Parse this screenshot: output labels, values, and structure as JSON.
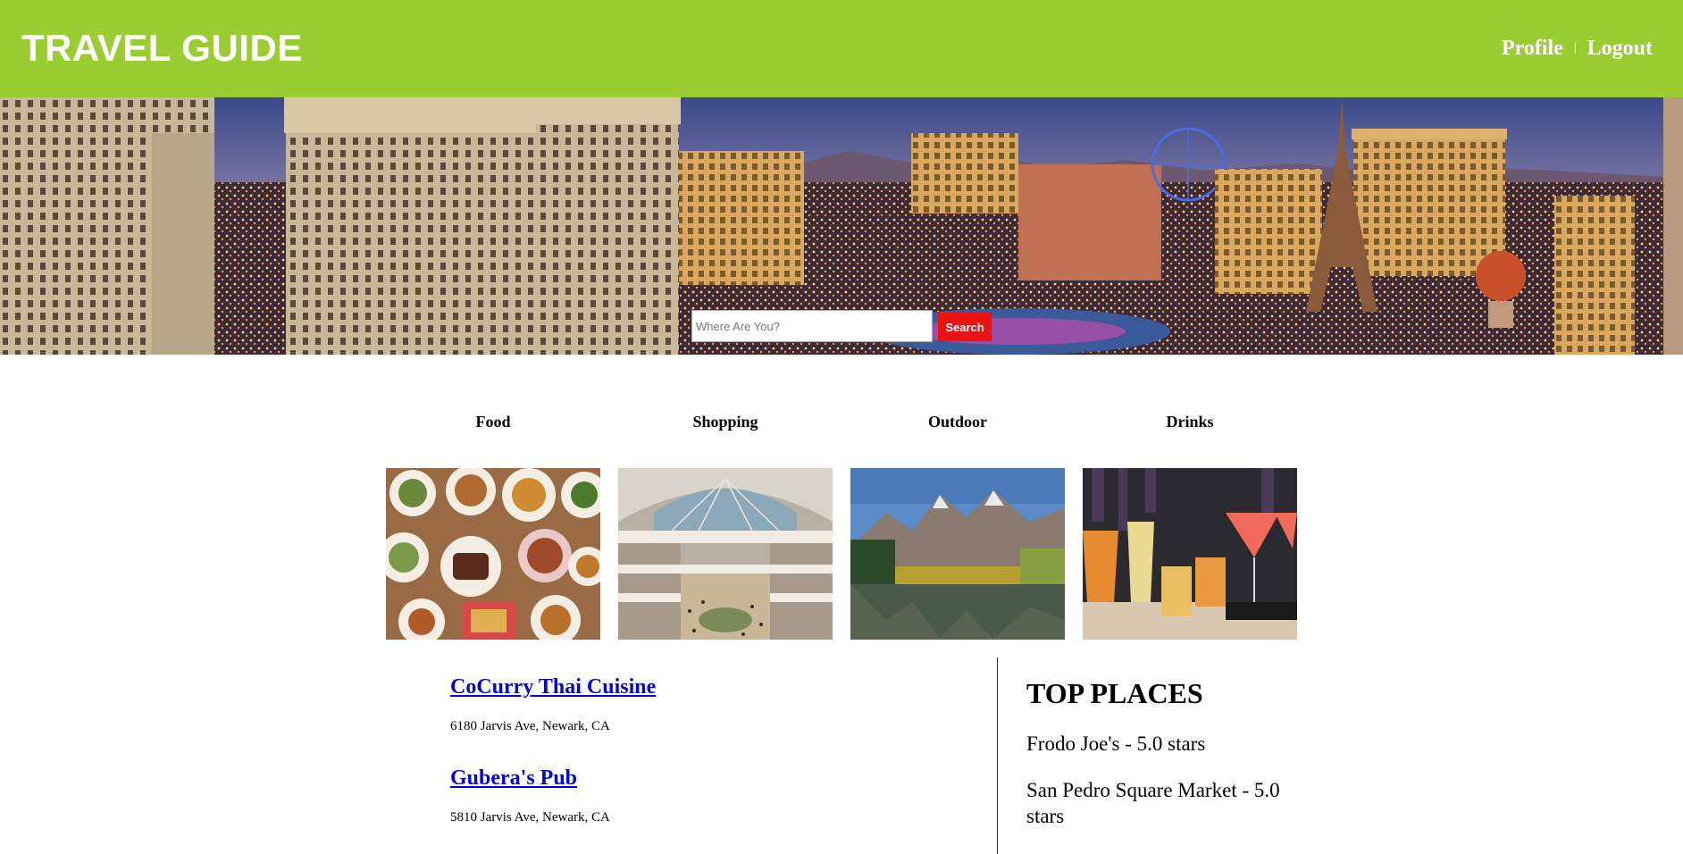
{
  "header": {
    "brand": "TRAVEL GUIDE",
    "nav": {
      "profile": "Profile",
      "separator": "|",
      "logout": "Logout"
    },
    "background_color": "#9acd32"
  },
  "hero": {
    "search_placeholder": "Where Are You?",
    "search_button": "Search",
    "search_button_color": "#ee1111"
  },
  "categories": [
    {
      "label": "Food"
    },
    {
      "label": "Shopping"
    },
    {
      "label": "Outdoor"
    },
    {
      "label": "Drinks"
    }
  ],
  "results": [
    {
      "name": "CoCurry Thai Cuisine",
      "address": "6180 Jarvis Ave, Newark, CA"
    },
    {
      "name": "Gubera's Pub",
      "address": "5810 Jarvis Ave, Newark, CA"
    }
  ],
  "top_places": {
    "heading": "TOP PLACES",
    "items": [
      "Frodo Joe's - 5.0 stars",
      "San Pedro Square Market - 5.0 stars"
    ]
  },
  "colors": {
    "link": "#0000ee"
  }
}
